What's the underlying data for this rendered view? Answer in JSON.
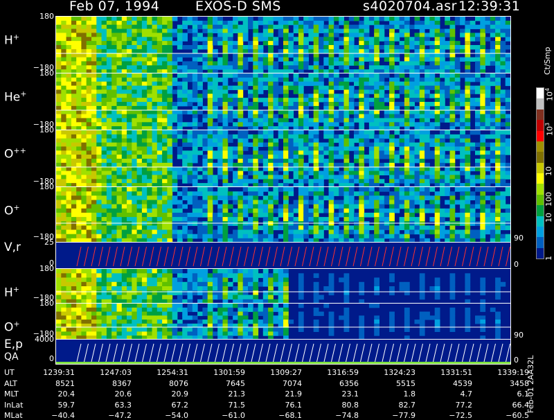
{
  "header": {
    "date": "Feb 07, 1994",
    "instrument": "EXOS-D SMS",
    "file": "s4020704.asr",
    "time": "12:39:31"
  },
  "chart_data": {
    "type": "heatmap",
    "panels": [
      {
        "species": "H",
        "charge": "+",
        "ymax": "180",
        "ymin": "−180"
      },
      {
        "species": "He",
        "charge": "+",
        "ymax": "180",
        "ymin": "−180"
      },
      {
        "species": "O",
        "charge": "++",
        "ymax": "180",
        "ymin": "−180"
      },
      {
        "species": "O",
        "charge": "+",
        "ymax": "180",
        "ymin": "−180",
        "right_tick": "90"
      },
      {
        "species": "V,r",
        "charge": "",
        "ymax": "25",
        "ymin": "0",
        "right_tick": "0"
      },
      {
        "species": "H",
        "charge": "+",
        "ymax": "180",
        "ymin": "−180"
      },
      {
        "species": "O",
        "charge": "+",
        "ymax": "180",
        "ymin": "−180",
        "right_tick": "90"
      },
      {
        "species": "E,p",
        "species2": "QA",
        "ymax": "4000",
        "ymin": "0",
        "right_tick": "0"
      }
    ],
    "colorbar": {
      "unit": "Ct/Smp",
      "ticks": [
        "10",
        "10",
        "10",
        "100",
        "10",
        "1"
      ],
      "tick_exp": [
        "4",
        "3",
        "",
        "",
        "",
        ""
      ],
      "colors": [
        "#ffffff",
        "#c0c0c0",
        "#803020",
        "#c00000",
        "#ff0000",
        "#a09000",
        "#807000",
        "#c8c800",
        "#ffff00",
        "#a0e000",
        "#60c000",
        "#00a040",
        "#00c0c0",
        "#00a0e0",
        "#0060c0",
        "#001a8a"
      ]
    },
    "ephemeris": {
      "UT": [
        "1239:31",
        "1247:03",
        "1254:31",
        "1301:59",
        "1309:27",
        "1316:59",
        "1324:23",
        "1331:51",
        "1339:19"
      ],
      "ALT": [
        "8521",
        "8367",
        "8076",
        "7645",
        "7074",
        "6356",
        "5515",
        "4539",
        "3458"
      ],
      "MLT": [
        "20.4",
        "20.6",
        "20.9",
        "21.3",
        "21.9",
        "23.1",
        "1.8",
        "4.7",
        "6.1"
      ],
      "InLat": [
        "59.7",
        "63.3",
        "67.2",
        "71.5",
        "76.1",
        "80.8",
        "82.7",
        "77.2",
        "66.4"
      ],
      "MLat": [
        "−40.4",
        "−47.2",
        "−54.0",
        "−61.0",
        "−68.1",
        "−74.8",
        "−77.9",
        "−72.5",
        "−60.5"
      ]
    },
    "footer_code": "Feb-01 2AA32L"
  }
}
